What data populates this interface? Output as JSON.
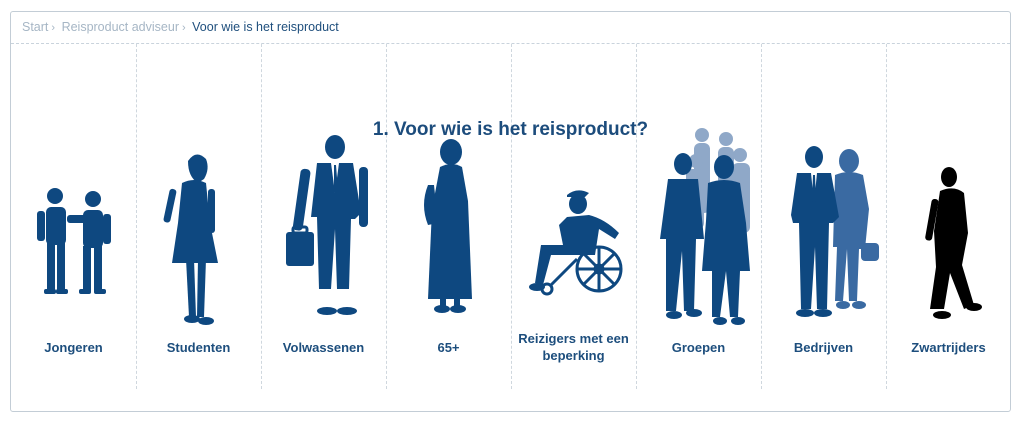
{
  "breadcrumb": {
    "items": [
      "Start",
      "Reisproduct adviseur"
    ],
    "separator": "›",
    "current": "Voor wie is het reisproduct"
  },
  "heading": "1. Voor wie is het reisproduct?",
  "categories": [
    {
      "label": "Jongeren",
      "icon": "two-boys-icon"
    },
    {
      "label": "Studenten",
      "icon": "young-woman-icon"
    },
    {
      "label": "Volwassenen",
      "icon": "businessman-briefcase-icon"
    },
    {
      "label": "65+",
      "icon": "elderly-woman-icon"
    },
    {
      "label": "Reizigers met een beperking",
      "icon": "wheelchair-user-icon"
    },
    {
      "label": "Groepen",
      "icon": "group-people-icon"
    },
    {
      "label": "Bedrijven",
      "icon": "business-couple-icon"
    },
    {
      "label": "Zwartrijders",
      "icon": "fare-dodger-icon"
    }
  ],
  "colors": {
    "figure": "#0e4880",
    "figure_light": "#8fa8c8",
    "figure_black": "#000000",
    "text": "#1d4e7d"
  }
}
